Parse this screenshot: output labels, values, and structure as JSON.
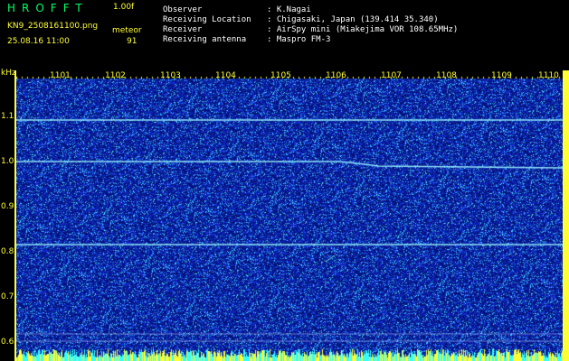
{
  "header": {
    "brand": "HROFFT",
    "version": "1.00f",
    "filename": "KN9_2508161100.png",
    "datetime": "25.08.16 11:00",
    "meteor_label": "meteor",
    "meteor_count": "91",
    "observer_label": "Observer",
    "observer_value": ": K.Nagai",
    "location_label": "Receiving Location",
    "location_value": ": Chigasaki, Japan (139.414 35.340)",
    "receiver_label": "Receiver",
    "receiver_value": ": AirSpy mini (Miakejima VOR 108.65MHz)",
    "antenna_label": "Receiving antenna",
    "antenna_value": ": Maspro FM-3"
  },
  "axes": {
    "y_unit": "kHz",
    "x_ticks": [
      "1101",
      "1102",
      "1103",
      "1104",
      "1105",
      "1106",
      "1107",
      "1108",
      "1109",
      "1110"
    ],
    "y_ticks": [
      "1.1",
      "1.0",
      "0.9",
      "0.8",
      "0.7",
      "0.6"
    ]
  },
  "colors": {
    "background": "#000000",
    "noise_dark": "#0a1a7a",
    "noise_mid": "#1e40d0",
    "noise_bright": "#4fe0ff",
    "trace": "#88f0ff",
    "axis": "#ffff33",
    "brand": "#00ff66"
  }
}
